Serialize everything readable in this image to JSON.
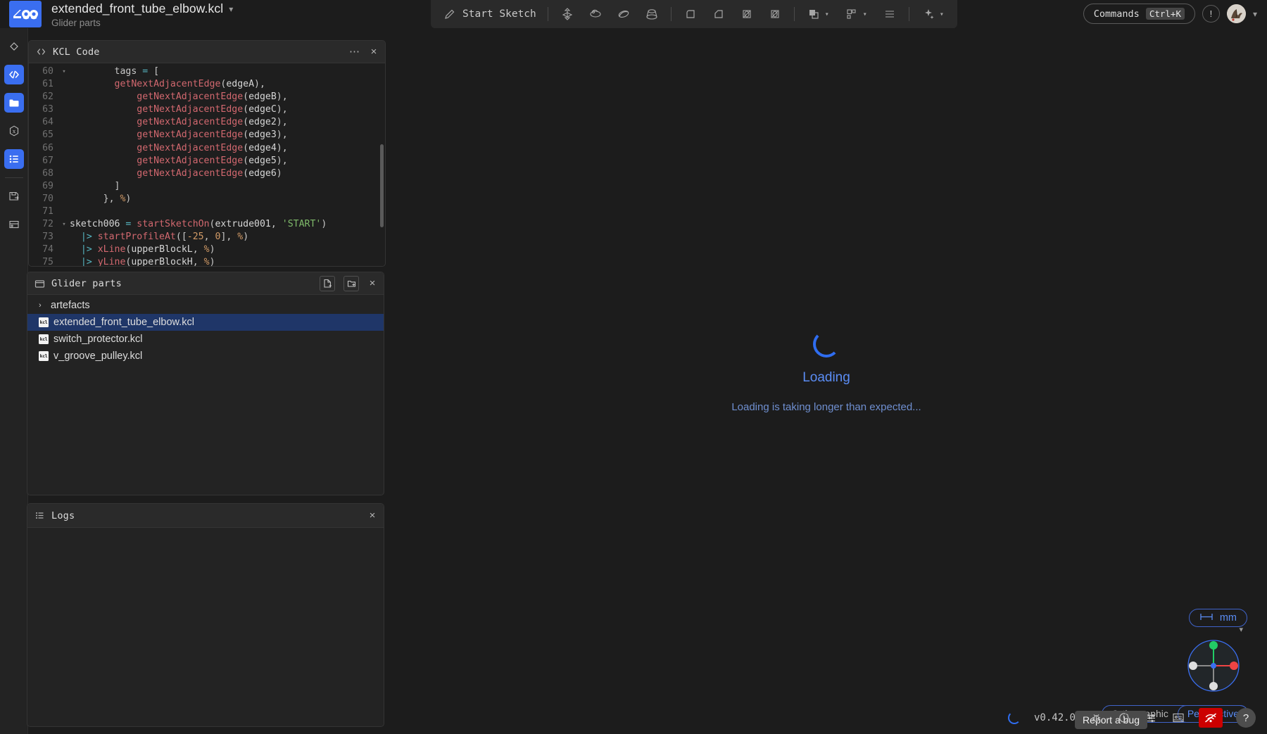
{
  "app": {
    "logo": "zoo-logo",
    "document_title": "extended_front_tube_elbow.kcl",
    "project_name": "Glider parts",
    "version": "v0.42.0",
    "accent": "#3a6ef0",
    "background": "#1c1c1c"
  },
  "toolbar": {
    "start_sketch_label": "Start Sketch",
    "icons": [
      "pencil-icon",
      "extrude-icon",
      "revolve-icon",
      "sweep-icon",
      "loft-icon",
      "fillet-icon",
      "chamfer-icon",
      "shell-icon",
      "hole-icon",
      "boolean-icon",
      "pattern-icon",
      "mirror-icon",
      "ai-sparkle-icon"
    ]
  },
  "topright": {
    "commands_label": "Commands",
    "commands_shortcut": "Ctrl+K",
    "notification_icon": "exclamation-icon",
    "avatar": "user-avatar",
    "avatar_caret": "chevron-down-icon"
  },
  "rail": {
    "items": [
      {
        "name": "model-icon",
        "active": false
      },
      {
        "name": "code-icon",
        "active": true
      },
      {
        "name": "files-icon",
        "active": true
      },
      {
        "name": "variables-icon",
        "active": false
      },
      {
        "name": "logs-icon",
        "active": true
      },
      {
        "name": "export-icon",
        "active": false
      },
      {
        "name": "debug-icon",
        "active": false
      }
    ]
  },
  "code_panel": {
    "title": "KCL Code",
    "icon": "code-brackets-icon",
    "menu_icon": "more-options-icon",
    "close_icon": "close-icon",
    "first_line": 60,
    "lines": [
      {
        "n": 60,
        "fold": true,
        "tokens": [
          [
            "pun",
            "        tags "
          ],
          [
            "op",
            "= "
          ],
          [
            "pun",
            "["
          ]
        ]
      },
      {
        "n": 61,
        "fold": false,
        "tokens": [
          [
            "pun",
            "        "
          ],
          [
            "fn",
            "getNextAdjacentEdge"
          ],
          [
            "pun",
            "("
          ],
          [
            "id",
            "edgeA"
          ],
          [
            "pun",
            "),"
          ]
        ]
      },
      {
        "n": 62,
        "fold": false,
        "tokens": [
          [
            "pun",
            "            "
          ],
          [
            "fn",
            "getNextAdjacentEdge"
          ],
          [
            "pun",
            "("
          ],
          [
            "id",
            "edgeB"
          ],
          [
            "pun",
            "),"
          ]
        ]
      },
      {
        "n": 63,
        "fold": false,
        "tokens": [
          [
            "pun",
            "            "
          ],
          [
            "fn",
            "getNextAdjacentEdge"
          ],
          [
            "pun",
            "("
          ],
          [
            "id",
            "edgeC"
          ],
          [
            "pun",
            "),"
          ]
        ]
      },
      {
        "n": 64,
        "fold": false,
        "tokens": [
          [
            "pun",
            "            "
          ],
          [
            "fn",
            "getNextAdjacentEdge"
          ],
          [
            "pun",
            "("
          ],
          [
            "id",
            "edge2"
          ],
          [
            "pun",
            "),"
          ]
        ]
      },
      {
        "n": 65,
        "fold": false,
        "tokens": [
          [
            "pun",
            "            "
          ],
          [
            "fn",
            "getNextAdjacentEdge"
          ],
          [
            "pun",
            "("
          ],
          [
            "id",
            "edge3"
          ],
          [
            "pun",
            "),"
          ]
        ]
      },
      {
        "n": 66,
        "fold": false,
        "tokens": [
          [
            "pun",
            "            "
          ],
          [
            "fn",
            "getNextAdjacentEdge"
          ],
          [
            "pun",
            "("
          ],
          [
            "id",
            "edge4"
          ],
          [
            "pun",
            "),"
          ]
        ]
      },
      {
        "n": 67,
        "fold": false,
        "tokens": [
          [
            "pun",
            "            "
          ],
          [
            "fn",
            "getNextAdjacentEdge"
          ],
          [
            "pun",
            "("
          ],
          [
            "id",
            "edge5"
          ],
          [
            "pun",
            "),"
          ]
        ]
      },
      {
        "n": 68,
        "fold": false,
        "tokens": [
          [
            "pun",
            "            "
          ],
          [
            "fn",
            "getNextAdjacentEdge"
          ],
          [
            "pun",
            "("
          ],
          [
            "id",
            "edge6"
          ],
          [
            "pun",
            ")"
          ]
        ]
      },
      {
        "n": 69,
        "fold": false,
        "tokens": [
          [
            "pun",
            "        ]"
          ]
        ]
      },
      {
        "n": 70,
        "fold": false,
        "tokens": [
          [
            "pun",
            "      }, "
          ],
          [
            "pct",
            "%"
          ],
          [
            "pun",
            ")"
          ]
        ]
      },
      {
        "n": 71,
        "fold": false,
        "tokens": [
          [
            "pun",
            ""
          ]
        ]
      },
      {
        "n": 72,
        "fold": true,
        "tokens": [
          [
            "id",
            "sketch006 "
          ],
          [
            "op",
            "= "
          ],
          [
            "fn",
            "startSketchOn"
          ],
          [
            "pun",
            "("
          ],
          [
            "id",
            "extrude001"
          ],
          [
            "pun",
            ", "
          ],
          [
            "str",
            "'START'"
          ],
          [
            "pun",
            ")"
          ]
        ]
      },
      {
        "n": 73,
        "fold": false,
        "tokens": [
          [
            "pun",
            "  "
          ],
          [
            "pipe",
            "|> "
          ],
          [
            "fn",
            "startProfileAt"
          ],
          [
            "pun",
            "(["
          ],
          [
            "num",
            "-25"
          ],
          [
            "pun",
            ", "
          ],
          [
            "num",
            "0"
          ],
          [
            "pun",
            "], "
          ],
          [
            "pct",
            "%"
          ],
          [
            "pun",
            ")"
          ]
        ]
      },
      {
        "n": 74,
        "fold": false,
        "tokens": [
          [
            "pun",
            "  "
          ],
          [
            "pipe",
            "|> "
          ],
          [
            "fn",
            "xLine"
          ],
          [
            "pun",
            "("
          ],
          [
            "id",
            "upperBlockL"
          ],
          [
            "pun",
            ", "
          ],
          [
            "pct",
            "%"
          ],
          [
            "pun",
            ")"
          ]
        ]
      },
      {
        "n": 75,
        "fold": false,
        "tokens": [
          [
            "pun",
            "  "
          ],
          [
            "pipe",
            "|> "
          ],
          [
            "fn",
            "yLine"
          ],
          [
            "pun",
            "("
          ],
          [
            "id",
            "upperBlockH"
          ],
          [
            "pun",
            ", "
          ],
          [
            "pct",
            "%"
          ],
          [
            "pun",
            ")"
          ]
        ]
      }
    ]
  },
  "files_panel": {
    "title": "Glider parts",
    "icon": "folder-icon",
    "new_file_icon": "new-file-icon",
    "new_folder_icon": "new-folder-icon",
    "close_icon": "close-icon",
    "items": [
      {
        "label": "artefacts",
        "type": "folder",
        "selected": false,
        "icon": "chevron-right-icon"
      },
      {
        "label": "extended_front_tube_elbow.kcl",
        "type": "file",
        "selected": true,
        "icon": "kcl-file-icon"
      },
      {
        "label": "switch_protector.kcl",
        "type": "file",
        "selected": false,
        "icon": "kcl-file-icon"
      },
      {
        "label": "v_groove_pulley.kcl",
        "type": "file",
        "selected": false,
        "icon": "kcl-file-icon"
      }
    ]
  },
  "logs_panel": {
    "title": "Logs",
    "icon": "list-icon",
    "close_icon": "close-icon",
    "content": ""
  },
  "viewport": {
    "loading_title": "Loading",
    "loading_subtitle": "Loading is taking longer than expected...",
    "spinner": "loading-spinner",
    "units_label": "mm",
    "units_icon": "measure-icon",
    "projection_ortho": "Orthographic",
    "projection_persp": "Perspective",
    "projection_selected": "Perspective",
    "tooltip": "Report a bug",
    "axis_colors": {
      "x": "#ee4444",
      "y": "#22cc66",
      "z": "#3a6ef0"
    }
  },
  "status_bar": {
    "version": "v0.42.0",
    "icons": [
      "bug-icon",
      "performance-icon",
      "settings-sliders-icon",
      "network-panel-icon",
      "no-connection-icon",
      "help-icon"
    ]
  }
}
